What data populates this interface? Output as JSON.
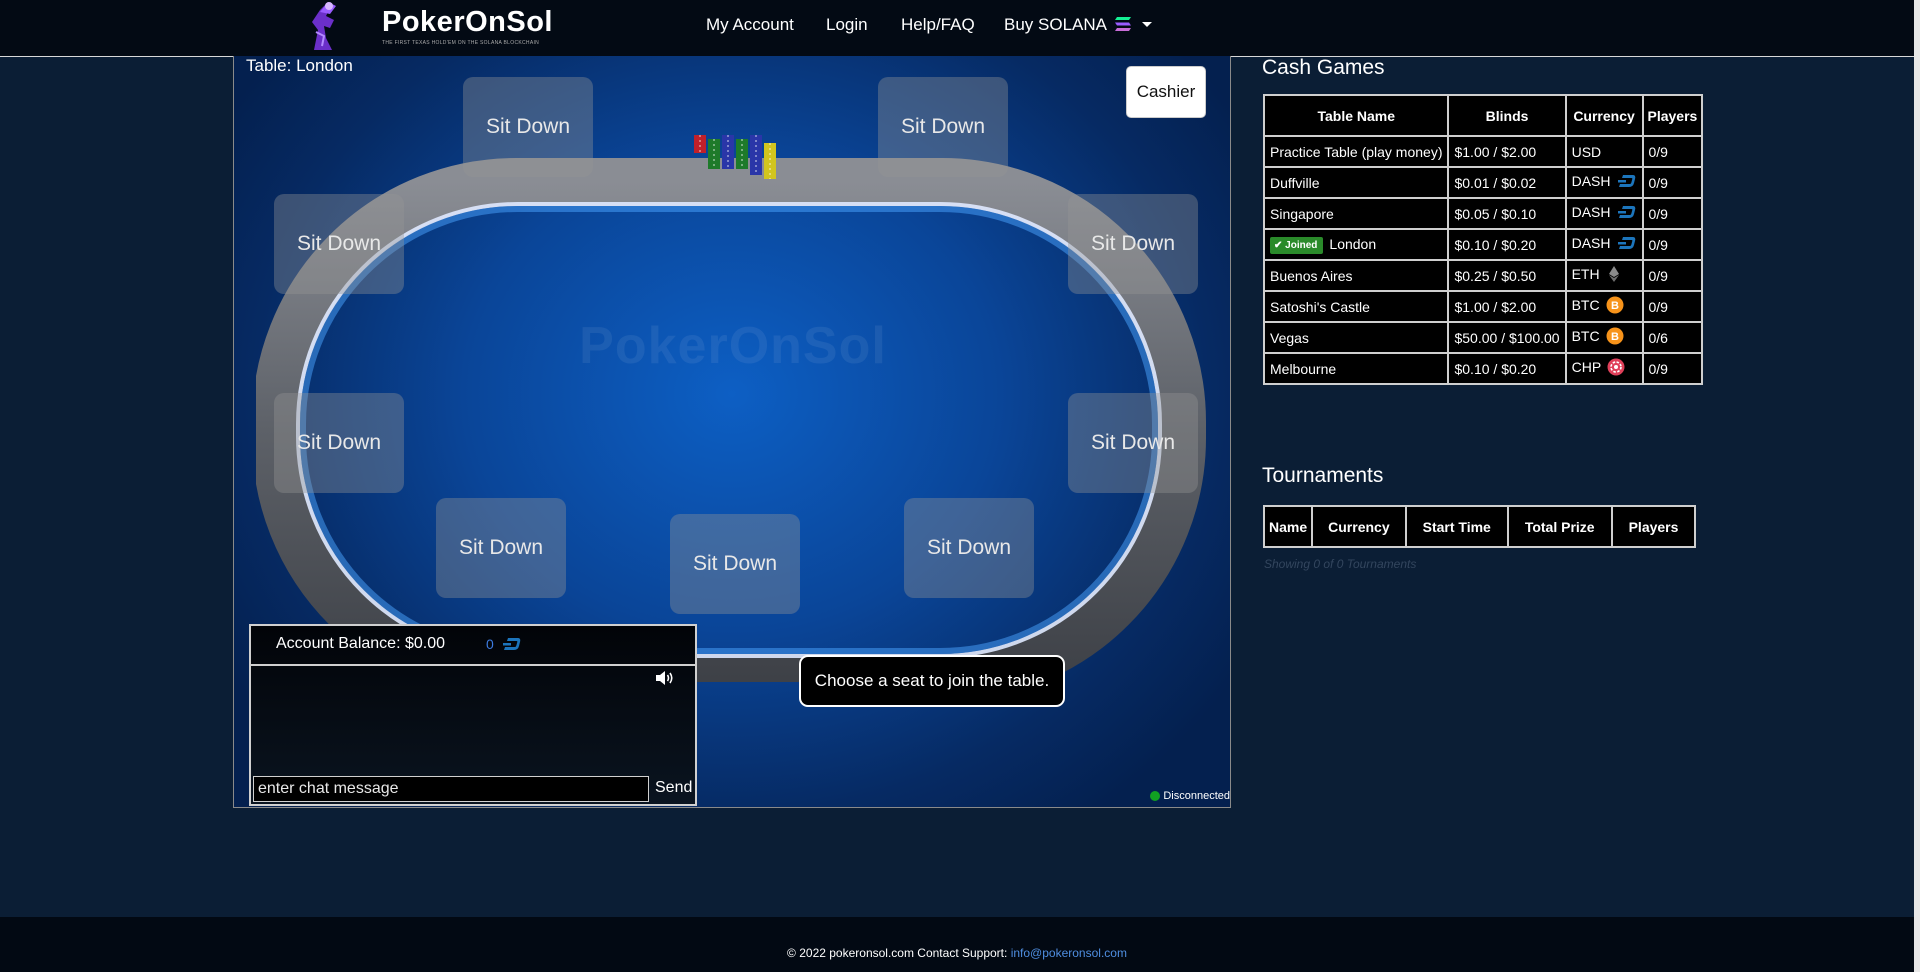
{
  "navbar": {
    "brand": "PokerOnSol",
    "tagline": "THE FIRST TEXAS HOLD'EM ON THE SOLANA BLOCKCHAIN",
    "links": [
      "My Account",
      "Login",
      "Help/FAQ"
    ],
    "buy_label": "Buy SOLANA"
  },
  "table": {
    "title": "Table: London",
    "cashier_label": "Cashier",
    "watermark": "PokerOnSol",
    "seat_label": "Sit Down",
    "prompt": "Choose a seat to join the table.",
    "balance": "Account Balance: $0.00",
    "balance_coin": "0",
    "chat_placeholder": "enter chat message",
    "send_label": "Send",
    "connection_status": "Disconnected"
  },
  "cash_games": {
    "title": "Cash Games",
    "columns": [
      "Table Name",
      "Blinds",
      "Currency",
      "Players"
    ],
    "joined_label": "Joined",
    "rows": [
      {
        "name": "Practice Table (play money)",
        "blinds": "$1.00 / $2.00",
        "currency": "USD",
        "icon": "",
        "players": "0/9",
        "joined": false
      },
      {
        "name": "Duffville",
        "blinds": "$0.01 / $0.02",
        "currency": "DASH",
        "icon": "dash-icon",
        "players": "0/9",
        "joined": false
      },
      {
        "name": "Singapore",
        "blinds": "$0.05 / $0.10",
        "currency": "DASH",
        "icon": "dash-icon",
        "players": "0/9",
        "joined": false
      },
      {
        "name": "London",
        "blinds": "$0.10 / $0.20",
        "currency": "DASH",
        "icon": "dash-icon",
        "players": "0/9",
        "joined": true
      },
      {
        "name": "Buenos Aires",
        "blinds": "$0.25 / $0.50",
        "currency": "ETH",
        "icon": "eth-icon",
        "players": "0/9",
        "joined": false
      },
      {
        "name": "Satoshi's Castle",
        "blinds": "$1.00 / $2.00",
        "currency": "BTC",
        "icon": "btc-icon",
        "players": "0/9",
        "joined": false
      },
      {
        "name": "Vegas",
        "blinds": "$50.00 / $100.00",
        "currency": "BTC",
        "icon": "btc-icon",
        "players": "0/6",
        "joined": false
      },
      {
        "name": "Melbourne",
        "blinds": "$0.10 / $0.20",
        "currency": "CHP",
        "icon": "chp-icon",
        "players": "0/9",
        "joined": false
      }
    ]
  },
  "tournaments": {
    "title": "Tournaments",
    "columns": [
      "Name",
      "Currency",
      "Start Time",
      "Total Prize",
      "Players"
    ],
    "footnote": "Showing 0 of 0 Tournaments"
  },
  "footer": {
    "text": "© 2022 pokeronsol.com Contact Support:",
    "email": "info@pokeronsol.com"
  },
  "colors": {
    "background": "#0b1e35",
    "felt": "#0a4598",
    "link": "#4f8ee0",
    "joined_badge": "#2a8a2a",
    "dash": "#1c75bc",
    "btc": "#f7931a",
    "chp": "#e0405a",
    "connection_dot": "#11a022"
  }
}
